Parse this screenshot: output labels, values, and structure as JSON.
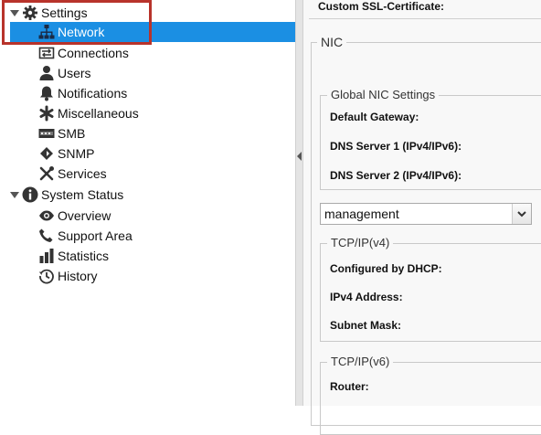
{
  "sidebar": {
    "settings": {
      "label": "Settings",
      "icon": "gear-icon"
    },
    "settings_items": [
      {
        "label": "Network",
        "icon": "network-icon",
        "selected": true
      },
      {
        "label": "Connections",
        "icon": "connections-icon"
      },
      {
        "label": "Users",
        "icon": "user-icon"
      },
      {
        "label": "Notifications",
        "icon": "bell-icon"
      },
      {
        "label": "Miscellaneous",
        "icon": "asterisk-icon"
      },
      {
        "label": "SMB",
        "icon": "smb-icon"
      },
      {
        "label": "SNMP",
        "icon": "snmp-icon"
      },
      {
        "label": "Services",
        "icon": "tools-icon"
      }
    ],
    "status": {
      "label": "System Status",
      "icon": "info-icon"
    },
    "status_items": [
      {
        "label": "Overview",
        "icon": "eye-icon"
      },
      {
        "label": "Support Area",
        "icon": "phone-icon"
      },
      {
        "label": "Statistics",
        "icon": "bar-chart-icon"
      },
      {
        "label": "History",
        "icon": "history-icon"
      }
    ],
    "selected_color": "#1b8fe3",
    "highlight_color": "#b8332b"
  },
  "main": {
    "ssl_label": "Custom SSL-Certificate:",
    "nic_legend": "NIC",
    "global_legend": "Global NIC Settings",
    "default_gateway": "Default Gateway:",
    "dns1": "DNS Server 1 (IPv4/IPv6):",
    "dns2": "DNS Server 2 (IPv4/IPv6):",
    "nic_select_value": "management",
    "ipv4_legend": "TCP/IP(v4)",
    "configured_dhcp": "Configured by DHCP:",
    "ipv4_address": "IPv4 Address:",
    "subnet_mask": "Subnet Mask:",
    "ipv6_legend": "TCP/IP(v6)",
    "router": "Router:"
  }
}
